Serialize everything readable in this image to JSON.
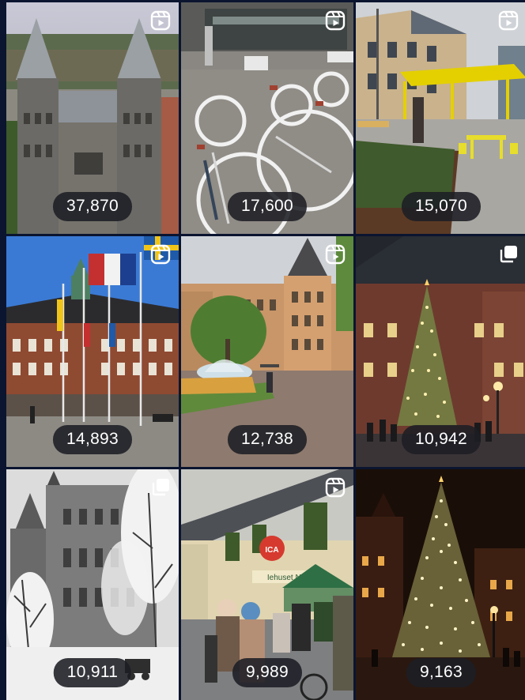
{
  "grid": {
    "tiles": [
      {
        "count": "37,870",
        "badge": "reel-icon"
      },
      {
        "count": "17,600",
        "badge": "reel-icon"
      },
      {
        "count": "15,070",
        "badge": "reel-icon"
      },
      {
        "count": "14,893",
        "badge": "reel-icon"
      },
      {
        "count": "12,738",
        "badge": "reel-icon"
      },
      {
        "count": "10,942",
        "badge": "carousel-icon"
      },
      {
        "count": "10,911",
        "badge": "carousel-icon"
      },
      {
        "count": "9,989",
        "badge": "reel-icon"
      },
      {
        "count": "9,163",
        "badge": "none"
      }
    ]
  },
  "signs": {
    "kiosk_label": "ICA",
    "shop_sign": "Iehuset N/A"
  },
  "colors": {
    "page_background": "#0b1530",
    "count_pill": "#1c1e24"
  }
}
